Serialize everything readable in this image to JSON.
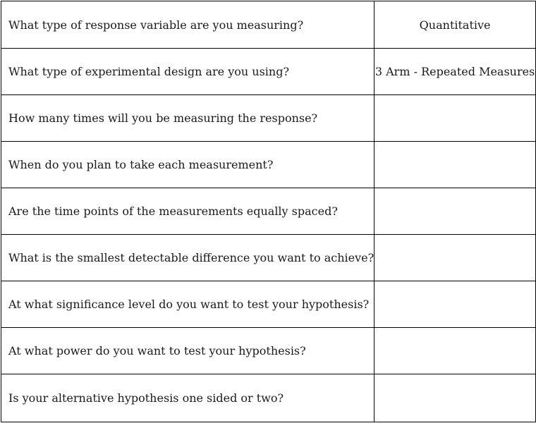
{
  "table": {
    "rows": [
      {
        "question": "What type of response variable are you measuring?",
        "answer": "Quantitative"
      },
      {
        "question": "What type of experimental design are you using?",
        "answer": "3 Arm - Repeated Measures"
      },
      {
        "question": "How many times will you be measuring the response?",
        "answer": ""
      },
      {
        "question": "When do you plan to take each measurement?",
        "answer": ""
      },
      {
        "question": "Are the time points of the measurements equally spaced?",
        "answer": ""
      },
      {
        "question": "What is the smallest detectable difference you want to achieve?",
        "answer": ""
      },
      {
        "question": "At what significance level do you want to test your hypothesis?",
        "answer": ""
      },
      {
        "question": "At what power do you want to test your hypothesis?",
        "answer": ""
      },
      {
        "question": "Is your alternative hypothesis one sided or two?",
        "answer": ""
      }
    ]
  }
}
